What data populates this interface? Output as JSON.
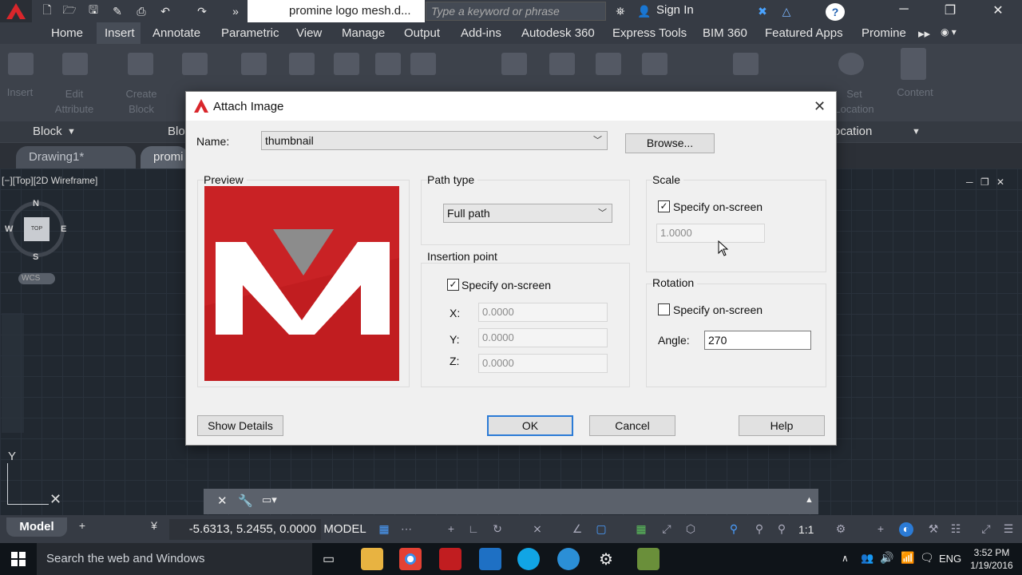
{
  "window": {
    "doc_title": "promine logo mesh.d...",
    "search_placeholder": "Type a keyword or phrase",
    "sign_in": "Sign In"
  },
  "ribbon": {
    "tabs": [
      "Home",
      "Insert",
      "Annotate",
      "Parametric",
      "View",
      "Manage",
      "Output",
      "Add-ins",
      "Autodesk 360",
      "Express Tools",
      "BIM 360",
      "Featured Apps",
      "Promine"
    ],
    "active_tab": "Insert",
    "buttons": {
      "insert": "Insert",
      "edit_attribute": "Edit Attribute",
      "create_block": "Create Block",
      "set_location": "Set Location",
      "content": "Content"
    },
    "panels": {
      "block": "Block",
      "block_def": "Blo",
      "location": "ocation"
    }
  },
  "document_tabs": [
    "Drawing1*",
    "promi"
  ],
  "viewport": {
    "label": "[−][Top][2D Wireframe]",
    "viewcube": {
      "face": "TOP",
      "n": "N",
      "s": "S",
      "e": "E",
      "w": "W"
    },
    "wcs": "WCS",
    "ucs_y": "Y"
  },
  "status_bar": {
    "model_tab": "Model",
    "coordinates": "-5.6313, 5.2455, 0.0000",
    "mode": "MODEL",
    "scale": "1:1"
  },
  "taskbar": {
    "search": "Search the web and Windows",
    "lang": "ENG",
    "time": "3:52 PM",
    "date": "1/19/2016"
  },
  "dialog": {
    "title": "Attach Image",
    "name_label": "Name:",
    "name_value": "thumbnail",
    "browse": "Browse...",
    "preview_title": "Preview",
    "path_type": {
      "title": "Path type",
      "value": "Full path"
    },
    "insertion_point": {
      "title": "Insertion point",
      "specify_label": "Specify on-screen",
      "specify_checked": true,
      "x_label": "X:",
      "x_value": "0.0000",
      "y_label": "Y:",
      "y_value": "0.0000",
      "z_label": "Z:",
      "z_value": "0.0000"
    },
    "scale": {
      "title": "Scale",
      "specify_label": "Specify on-screen",
      "specify_checked": true,
      "value": "1.0000"
    },
    "rotation": {
      "title": "Rotation",
      "specify_label": "Specify on-screen",
      "specify_checked": false,
      "angle_label": "Angle:",
      "angle_value": "270"
    },
    "buttons": {
      "show_details": "Show Details",
      "ok": "OK",
      "cancel": "Cancel",
      "help": "Help"
    }
  },
  "colors": {
    "logo_red": "#c11d20",
    "logo_gray": "#8c8c8c",
    "accent_blue": "#2b7bd6"
  }
}
